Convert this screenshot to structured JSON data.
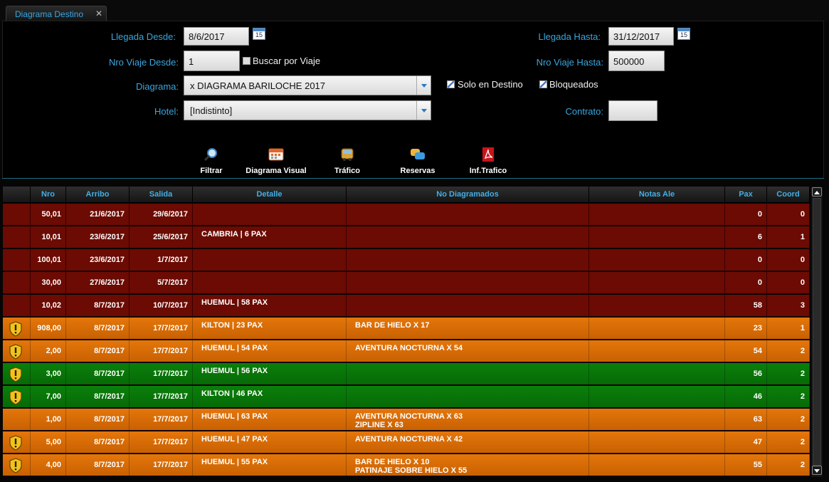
{
  "tab": {
    "label": "Diagrama Destino",
    "close": "✕"
  },
  "filters": {
    "llegada_desde_label": "Llegada Desde:",
    "llegada_desde_value": "8/6/2017",
    "llegada_hasta_label": "Llegada Hasta:",
    "llegada_hasta_value": "31/12/2017",
    "calendar_text": "15",
    "nro_viaje_desde_label": "Nro Viaje Desde:",
    "nro_viaje_desde_value": "1",
    "buscar_por_viaje_label": "Buscar por Viaje",
    "nro_viaje_hasta_label": "Nro Viaje Hasta:",
    "nro_viaje_hasta_value": "500000",
    "diagrama_label": "Diagrama:",
    "diagrama_value": "x DIAGRAMA BARILOCHE 2017",
    "solo_en_destino_label": "Solo en Destino",
    "bloqueados_label": "Bloqueados",
    "hotel_label": "Hotel:",
    "hotel_value": "[Indistinto]",
    "contrato_label": "Contrato:",
    "contrato_value": ""
  },
  "toolbar": {
    "filtrar": "Filtrar",
    "diagrama_visual": "Diagrama Visual",
    "trafico": "Tráfico",
    "reservas": "Reservas",
    "inf_trafico": "Inf.Trafico"
  },
  "grid": {
    "columns": [
      "",
      "Nro",
      "Arribo",
      "Salida",
      "Detalle",
      "No Diagramados",
      "Notas Ale",
      "Pax",
      "Coord"
    ],
    "rows": [
      {
        "color": "dark",
        "warn": false,
        "nro": "50,01",
        "arribo": "21/6/2017",
        "salida": "29/6/2017",
        "detalle": "",
        "nodiag1": "",
        "nodiag2": "",
        "notas": "",
        "pax": "0",
        "coord": "0"
      },
      {
        "color": "dark",
        "warn": false,
        "nro": "10,01",
        "arribo": "23/6/2017",
        "salida": "25/6/2017",
        "detalle": "CAMBRIA | 6 PAX",
        "nodiag1": "",
        "nodiag2": "",
        "notas": "",
        "pax": "6",
        "coord": "1"
      },
      {
        "color": "dark",
        "warn": false,
        "nro": "100,01",
        "arribo": "23/6/2017",
        "salida": "1/7/2017",
        "detalle": "",
        "nodiag1": "",
        "nodiag2": "",
        "notas": "",
        "pax": "0",
        "coord": "0"
      },
      {
        "color": "dark",
        "warn": false,
        "nro": "30,00",
        "arribo": "27/6/2017",
        "salida": "5/7/2017",
        "detalle": "",
        "nodiag1": "",
        "nodiag2": "",
        "notas": "",
        "pax": "0",
        "coord": "0"
      },
      {
        "color": "dark",
        "warn": false,
        "nro": "10,02",
        "arribo": "8/7/2017",
        "salida": "10/7/2017",
        "detalle": "HUEMUL | 58 PAX",
        "nodiag1": "",
        "nodiag2": "",
        "notas": "",
        "pax": "58",
        "coord": "3"
      },
      {
        "color": "orange",
        "warn": true,
        "nro": "908,00",
        "arribo": "8/7/2017",
        "salida": "17/7/2017",
        "detalle": "KILTON | 23 PAX",
        "nodiag1": "BAR DE HIELO X 17",
        "nodiag2": "",
        "notas": "",
        "pax": "23",
        "coord": "1"
      },
      {
        "color": "orange",
        "warn": true,
        "nro": "2,00",
        "arribo": "8/7/2017",
        "salida": "17/7/2017",
        "detalle": "HUEMUL | 54 PAX",
        "nodiag1": "AVENTURA NOCTURNA X 54",
        "nodiag2": "",
        "notas": "",
        "pax": "54",
        "coord": "2"
      },
      {
        "color": "green",
        "warn": true,
        "nro": "3,00",
        "arribo": "8/7/2017",
        "salida": "17/7/2017",
        "detalle": "HUEMUL | 56 PAX",
        "nodiag1": "",
        "nodiag2": "",
        "notas": "",
        "pax": "56",
        "coord": "2"
      },
      {
        "color": "green",
        "warn": true,
        "nro": "7,00",
        "arribo": "8/7/2017",
        "salida": "17/7/2017",
        "detalle": "KILTON | 46 PAX",
        "nodiag1": "",
        "nodiag2": "",
        "notas": "",
        "pax": "46",
        "coord": "2"
      },
      {
        "color": "orange",
        "warn": false,
        "nro": "1,00",
        "arribo": "8/7/2017",
        "salida": "17/7/2017",
        "detalle": "HUEMUL | 63 PAX",
        "nodiag1": "AVENTURA NOCTURNA X 63",
        "nodiag2": "ZIPLINE X 63",
        "notas": "",
        "pax": "63",
        "coord": "2"
      },
      {
        "color": "orange",
        "warn": true,
        "nro": "5,00",
        "arribo": "8/7/2017",
        "salida": "17/7/2017",
        "detalle": "HUEMUL | 47 PAX",
        "nodiag1": "AVENTURA NOCTURNA X 42",
        "nodiag2": "",
        "notas": "",
        "pax": "47",
        "coord": "2"
      },
      {
        "color": "orange",
        "warn": true,
        "nro": "4,00",
        "arribo": "8/7/2017",
        "salida": "17/7/2017",
        "detalle": "HUEMUL | 55 PAX",
        "nodiag1": "BAR DE HIELO X 10",
        "nodiag2": "PATINAJE SOBRE HIELO X 55",
        "notas": "",
        "pax": "55",
        "coord": "2"
      }
    ]
  },
  "colors": {
    "accent": "#3aa7e0",
    "row_dark": "#6b0b03",
    "row_orange": "#e4760a",
    "row_green": "#0b7f0b"
  }
}
